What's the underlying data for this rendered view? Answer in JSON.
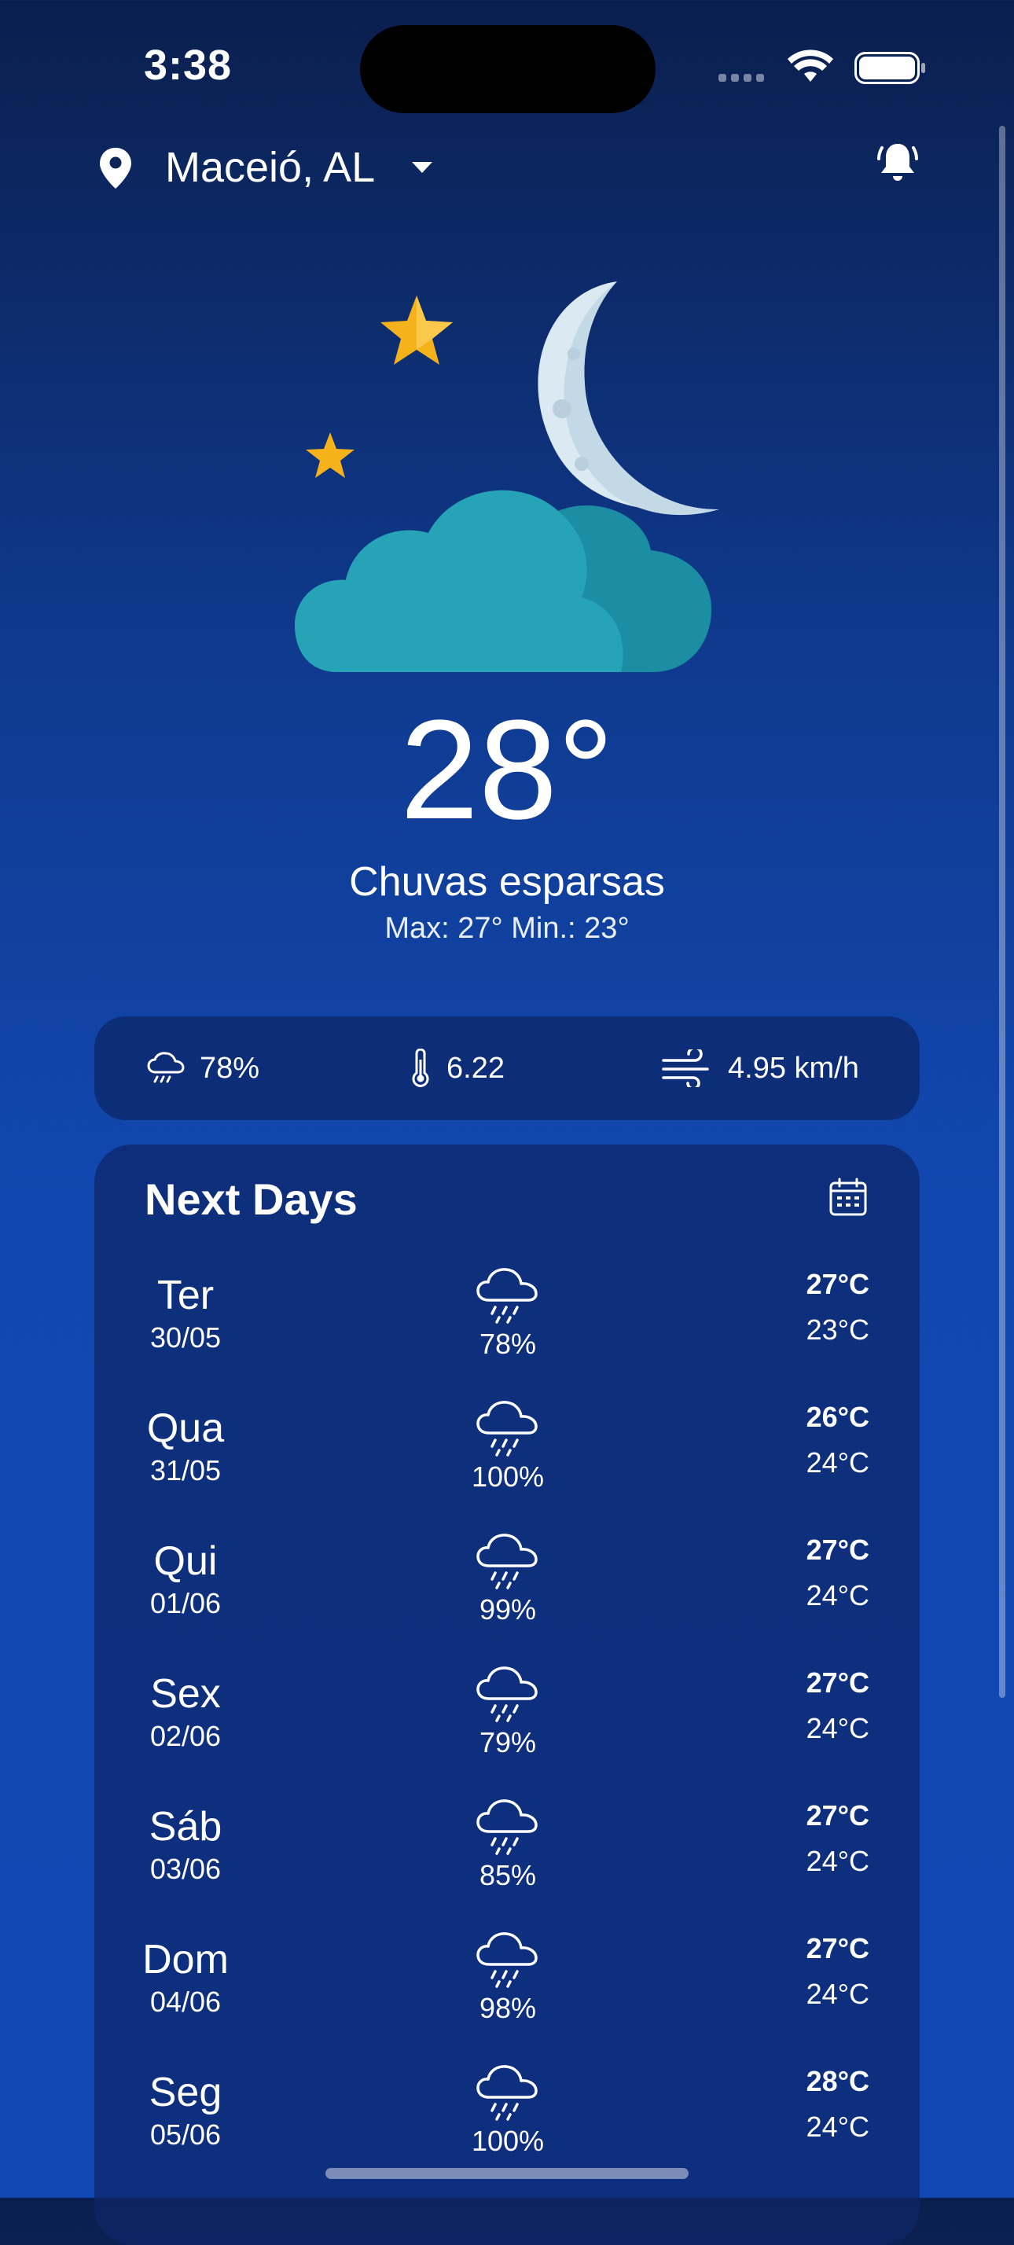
{
  "status_bar": {
    "time": "3:38"
  },
  "header": {
    "location": "Maceió, AL"
  },
  "current": {
    "temperature": "28°",
    "condition": "Chuvas esparsas",
    "minmax": "Max: 27° Min.: 23°"
  },
  "stats": {
    "rain": "78%",
    "uv": "6.22",
    "wind": "4.95 km/h"
  },
  "next_days": {
    "title": "Next Days",
    "days": [
      {
        "day": "Ter",
        "date": "30/05",
        "rain": "78%",
        "max": "27°C",
        "min": "23°C"
      },
      {
        "day": "Qua",
        "date": "31/05",
        "rain": "100%",
        "max": "26°C",
        "min": "24°C"
      },
      {
        "day": "Qui",
        "date": "01/06",
        "rain": "99%",
        "max": "27°C",
        "min": "24°C"
      },
      {
        "day": "Sex",
        "date": "02/06",
        "rain": "79%",
        "max": "27°C",
        "min": "24°C"
      },
      {
        "day": "Sáb",
        "date": "03/06",
        "rain": "85%",
        "max": "27°C",
        "min": "24°C"
      },
      {
        "day": "Dom",
        "date": "04/06",
        "rain": "98%",
        "max": "27°C",
        "min": "24°C"
      },
      {
        "day": "Seg",
        "date": "05/06",
        "rain": "100%",
        "max": "28°C",
        "min": "24°C"
      }
    ]
  },
  "icons": {
    "location": "location-pin-icon",
    "dropdown": "caret-down-icon",
    "notifications": "bell-icon",
    "weather": "moon-stars-cloud-icon",
    "rain": "rain-cloud-icon",
    "uv": "thermometer-icon",
    "wind": "wind-icon",
    "calendar": "calendar-icon"
  },
  "colors": {
    "cloud": "#27a3b7",
    "moon": "#d7e6f0",
    "star": "#f5b21b",
    "card": "#0e2668"
  }
}
